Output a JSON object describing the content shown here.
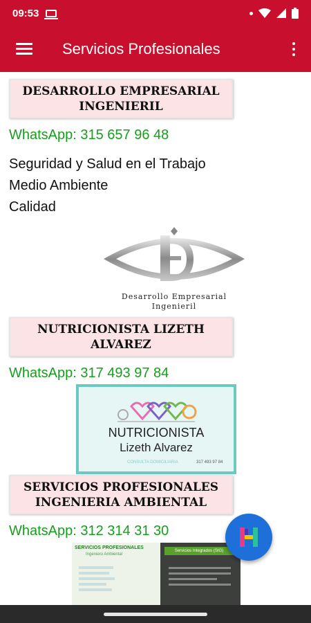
{
  "status_bar": {
    "time": "09:53"
  },
  "app_bar": {
    "title": "Servicios Profesionales"
  },
  "cards": [
    {
      "heading": "DESARROLLO EMPRESARIAL INGENIERIL",
      "whatsapp": "WhatsApp: 315 657 96 48",
      "services": [
        "Seguridad y Salud en el Trabajo",
        "Medio Ambiente",
        "Calidad"
      ],
      "logo": {
        "line1": "Desarrollo Empresarial",
        "line2": "Ingenieril"
      }
    },
    {
      "heading": "NUTRICIONISTA LIZETH ALVAREZ",
      "whatsapp": "WhatsApp: 317 493 97 84",
      "logo": {
        "title": "NUTRICIONISTA",
        "name": "Lizeth Alvarez",
        "tag": "CONSULTA DOMICILIARIA",
        "phone": "317 493 97 84"
      }
    },
    {
      "heading": "SERVICIOS PROFESIONALES INGENIERIA AMBIENTAL",
      "whatsapp": "WhatsApp: 312 314 31 30",
      "logo": {
        "title": "SERVICIOS PROFESIONALES",
        "subtitle": "Ingeniero Ambiental",
        "right_title": "Servicios Integrados (SIG)"
      }
    }
  ],
  "colors": {
    "primary": "#c8102e",
    "whatsapp": "#14a01a",
    "fab": "#1e6fd9",
    "heading_bg": "#fbe3e6"
  },
  "icons": {
    "menu": "hamburger-icon",
    "overflow": "more-vert-icon",
    "fab": "h-logo-icon"
  }
}
